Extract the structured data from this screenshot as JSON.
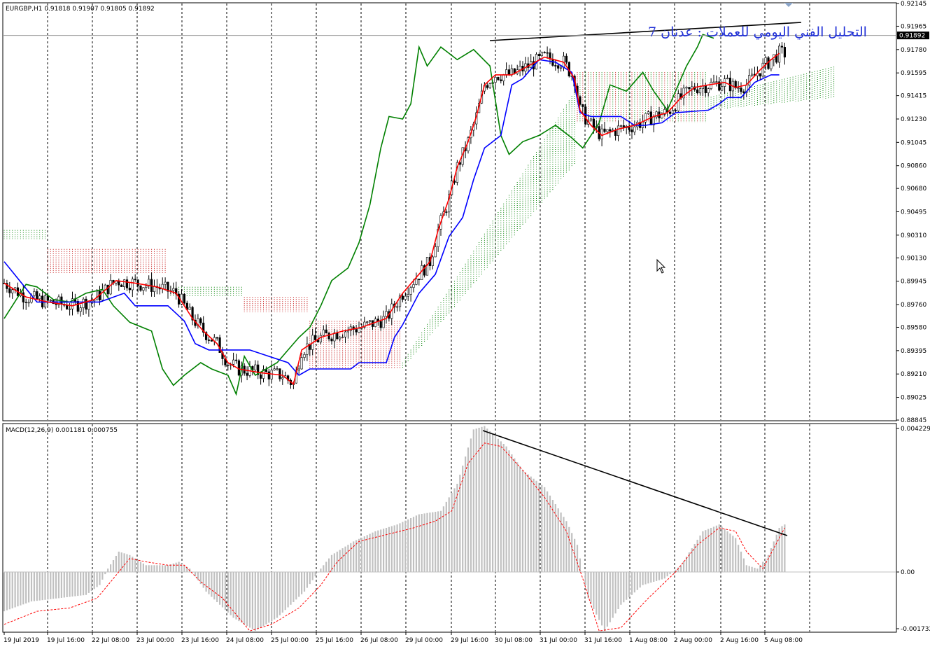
{
  "window": {
    "main_title": "EURGBP,H1  0.91818 0.91907 0.91805 0.91892",
    "macd_title": "MACD(12,26,9) 0.001181 0.000755",
    "annotation": "التحليل الفني اليومي للعملات : عدنان 7",
    "current_price_label": "0.91892"
  },
  "colors": {
    "tenkan": "#ff0000",
    "kijun": "#0000ff",
    "chikou": "#008000",
    "cloud_bull": "#008000",
    "cloud_bear": "#c00000",
    "histogram": "#c0c0c0",
    "signal": "#ff0000",
    "trendline": "#000000",
    "annotation": "#1f2fd6"
  },
  "chart_data": [
    {
      "type": "candlestick",
      "symbol": "EURGBP",
      "timeframe": "H1",
      "indicator": "Ichimoku",
      "ylim": [
        0.88845,
        0.92145
      ],
      "y_ticks": [
        "0.92145",
        "0.91965",
        "0.91780",
        "0.91595",
        "0.91415",
        "0.91230",
        "0.91045",
        "0.90860",
        "0.90680",
        "0.90495",
        "0.90310",
        "0.90130",
        "0.89945",
        "0.89760",
        "0.89580",
        "0.89395",
        "0.89210",
        "0.89025",
        "0.88845"
      ],
      "y_tick_values": [
        0.92145,
        0.91965,
        0.9178,
        0.91595,
        0.91415,
        0.9123,
        0.91045,
        0.9086,
        0.9068,
        0.90495,
        0.9031,
        0.9013,
        0.89945,
        0.8976,
        0.8958,
        0.89395,
        0.8921,
        0.89025,
        0.88845
      ],
      "current_price": 0.91892,
      "x_ticks": [
        "19 Jul 2019",
        "19 Jul 16:00",
        "22 Jul 08:00",
        "23 Jul 00:00",
        "23 Jul 16:00",
        "24 Jul 08:00",
        "25 Jul 00:00",
        "25 Jul 16:00",
        "26 Jul 08:00",
        "29 Jul 00:00",
        "29 Jul 16:00",
        "30 Jul 08:00",
        "31 Jul 00:00",
        "31 Jul 16:00",
        "1 Aug 08:00",
        "2 Aug 00:00",
        "2 Aug 16:00",
        "5 Aug 08:00"
      ],
      "tenkan": [
        [
          0,
          0.8993
        ],
        [
          8,
          0.8982
        ],
        [
          16,
          0.8978
        ],
        [
          25,
          0.8975
        ],
        [
          33,
          0.898
        ],
        [
          41,
          0.8995
        ],
        [
          48,
          0.8993
        ],
        [
          56,
          0.899
        ],
        [
          63,
          0.8985
        ],
        [
          69,
          0.8965
        ],
        [
          73,
          0.8955
        ],
        [
          78,
          0.8945
        ],
        [
          82,
          0.893
        ],
        [
          86,
          0.8925
        ],
        [
          94,
          0.8922
        ],
        [
          102,
          0.892
        ],
        [
          106,
          0.8913
        ],
        [
          109,
          0.894
        ],
        [
          116,
          0.895
        ],
        [
          124,
          0.8955
        ],
        [
          131,
          0.8958
        ],
        [
          140,
          0.8965
        ],
        [
          146,
          0.8985
        ],
        [
          152,
          0.9
        ],
        [
          156,
          0.901
        ],
        [
          159,
          0.9035
        ],
        [
          163,
          0.906
        ],
        [
          166,
          0.9085
        ],
        [
          170,
          0.9105
        ],
        [
          173,
          0.9125
        ],
        [
          176,
          0.915
        ],
        [
          180,
          0.9158
        ],
        [
          186,
          0.9158
        ],
        [
          192,
          0.9165
        ],
        [
          198,
          0.9172
        ],
        [
          205,
          0.9168
        ],
        [
          209,
          0.9155
        ],
        [
          211,
          0.913
        ],
        [
          215,
          0.9118
        ],
        [
          219,
          0.911
        ],
        [
          225,
          0.9115
        ],
        [
          231,
          0.9118
        ],
        [
          238,
          0.9125
        ],
        [
          243,
          0.9128
        ],
        [
          248,
          0.914
        ],
        [
          253,
          0.9148
        ],
        [
          258,
          0.915
        ],
        [
          264,
          0.9152
        ],
        [
          268,
          0.9148
        ],
        [
          272,
          0.915
        ],
        [
          277,
          0.9162
        ],
        [
          281,
          0.917
        ],
        [
          284,
          0.9175
        ]
      ],
      "kijun": [
        [
          0,
          0.901
        ],
        [
          12,
          0.8978
        ],
        [
          25,
          0.8978
        ],
        [
          35,
          0.8978
        ],
        [
          44,
          0.8985
        ],
        [
          48,
          0.8975
        ],
        [
          60,
          0.8975
        ],
        [
          66,
          0.8963
        ],
        [
          70,
          0.8945
        ],
        [
          75,
          0.894
        ],
        [
          90,
          0.894
        ],
        [
          104,
          0.893
        ],
        [
          108,
          0.892
        ],
        [
          112,
          0.8925
        ],
        [
          127,
          0.8925
        ],
        [
          130,
          0.893
        ],
        [
          140,
          0.893
        ],
        [
          143,
          0.895
        ],
        [
          146,
          0.896
        ],
        [
          152,
          0.8985
        ],
        [
          158,
          0.9
        ],
        [
          163,
          0.903
        ],
        [
          168,
          0.9045
        ],
        [
          172,
          0.9075
        ],
        [
          176,
          0.91
        ],
        [
          182,
          0.911
        ],
        [
          186,
          0.915
        ],
        [
          190,
          0.9155
        ],
        [
          196,
          0.917
        ],
        [
          202,
          0.9168
        ],
        [
          208,
          0.916
        ],
        [
          211,
          0.9128
        ],
        [
          215,
          0.9125
        ],
        [
          226,
          0.9125
        ],
        [
          231,
          0.9118
        ],
        [
          235,
          0.9118
        ],
        [
          241,
          0.912
        ],
        [
          246,
          0.9128
        ],
        [
          258,
          0.913
        ],
        [
          262,
          0.9135
        ],
        [
          265,
          0.914
        ],
        [
          270,
          0.914
        ],
        [
          275,
          0.9152
        ],
        [
          281,
          0.9158
        ],
        [
          284,
          0.9158
        ]
      ],
      "chikou": [
        [
          0,
          0.8965
        ],
        [
          8,
          0.8992
        ],
        [
          12,
          0.899
        ],
        [
          18,
          0.898
        ],
        [
          24,
          0.8978
        ],
        [
          30,
          0.8985
        ],
        [
          36,
          0.8988
        ],
        [
          40,
          0.8975
        ],
        [
          46,
          0.8962
        ],
        [
          54,
          0.8955
        ],
        [
          58,
          0.8925
        ],
        [
          62,
          0.8912
        ],
        [
          66,
          0.892
        ],
        [
          72,
          0.893
        ],
        [
          76,
          0.8925
        ],
        [
          82,
          0.892
        ],
        [
          85,
          0.8905
        ],
        [
          88,
          0.8935
        ],
        [
          92,
          0.892
        ],
        [
          100,
          0.893
        ],
        [
          104,
          0.894
        ],
        [
          108,
          0.895
        ],
        [
          112,
          0.8958
        ],
        [
          116,
          0.8975
        ],
        [
          120,
          0.8995
        ],
        [
          126,
          0.9005
        ],
        [
          130,
          0.9025
        ],
        [
          134,
          0.9055
        ],
        [
          138,
          0.91
        ],
        [
          141,
          0.9125
        ],
        [
          146,
          0.9123
        ],
        [
          149,
          0.9135
        ],
        [
          152,
          0.918
        ],
        [
          155,
          0.9165
        ],
        [
          160,
          0.918
        ],
        [
          166,
          0.917
        ],
        [
          172,
          0.9178
        ],
        [
          178,
          0.9165
        ],
        [
          182,
          0.911
        ],
        [
          185,
          0.9095
        ],
        [
          190,
          0.9105
        ],
        [
          196,
          0.911
        ],
        [
          202,
          0.9118
        ],
        [
          208,
          0.9108
        ],
        [
          212,
          0.91
        ],
        [
          218,
          0.912
        ],
        [
          222,
          0.915
        ],
        [
          228,
          0.9145
        ],
        [
          234,
          0.916
        ],
        [
          238,
          0.9145
        ],
        [
          243,
          0.913
        ],
        [
          246,
          0.9145
        ],
        [
          250,
          0.9165
        ],
        [
          254,
          0.918
        ],
        [
          256,
          0.919
        ],
        [
          260,
          0.9187
        ]
      ],
      "cloud": [
        {
          "from": 0,
          "to": 16,
          "senkou_a": 0.9035,
          "senkou_b": 0.9028,
          "color": "bull"
        },
        {
          "from": 16,
          "to": 60,
          "senkou_a": 0.9,
          "senkou_b": 0.902,
          "color": "bear"
        },
        {
          "from": 60,
          "to": 88,
          "senkou_a": 0.899,
          "senkou_b": 0.8982,
          "color": "bull"
        },
        {
          "from": 88,
          "to": 112,
          "senkou_a": 0.897,
          "senkou_b": 0.8982,
          "color": "bear"
        },
        {
          "from": 112,
          "to": 146,
          "senkou_a": 0.8963,
          "senkou_b": 0.8925,
          "color": "bear"
        },
        {
          "from": 146,
          "to": 210,
          "senkou_a_start": 0.893,
          "senkou_a_end": 0.9148,
          "senkou_b_start": 0.8925,
          "senkou_b_end": 0.909,
          "color": "bull"
        },
        {
          "from": 210,
          "to": 258,
          "senkou_a": 0.916,
          "senkou_b": 0.912,
          "color": "mixed"
        },
        {
          "from": 258,
          "to": 305,
          "senkou_a_start": 0.914,
          "senkou_a_end": 0.9165,
          "senkou_b_start": 0.913,
          "senkou_b_end": 0.914,
          "color": "bull"
        }
      ]
    },
    {
      "type": "bar",
      "indicator": "MACD",
      "params": "12,26,9",
      "ylim": [
        -0.001732,
        0.004229
      ],
      "y_ticks": [
        "0.004229",
        "0.00",
        "-0.001732"
      ],
      "y_tick_values": [
        0.004229,
        0.0,
        -0.001732
      ],
      "histogram": [
        [
          0,
          -0.0012
        ],
        [
          10,
          -0.0009
        ],
        [
          20,
          -0.0008
        ],
        [
          30,
          -0.0007
        ],
        [
          35,
          -0.0004
        ],
        [
          38,
          0.0001
        ],
        [
          42,
          0.0006
        ],
        [
          46,
          0.0005
        ],
        [
          52,
          0.0002
        ],
        [
          60,
          0.0002
        ],
        [
          64,
          0.0003
        ],
        [
          68,
          0.0001
        ],
        [
          74,
          -0.0006
        ],
        [
          84,
          -0.0014
        ],
        [
          92,
          -0.0018
        ],
        [
          100,
          -0.0014
        ],
        [
          110,
          -0.0006
        ],
        [
          116,
          0.0001
        ],
        [
          120,
          0.0005
        ],
        [
          128,
          0.0009
        ],
        [
          136,
          0.0012
        ],
        [
          144,
          0.0014
        ],
        [
          152,
          0.0017
        ],
        [
          160,
          0.0018
        ],
        [
          166,
          0.0026
        ],
        [
          172,
          0.0042
        ],
        [
          176,
          0.0043
        ],
        [
          180,
          0.004
        ],
        [
          184,
          0.0037
        ],
        [
          190,
          0.003
        ],
        [
          198,
          0.0025
        ],
        [
          206,
          0.0015
        ],
        [
          210,
          0.0008
        ],
        [
          214,
          -0.0008
        ],
        [
          220,
          -0.0018
        ],
        [
          226,
          -0.001
        ],
        [
          234,
          -0.0004
        ],
        [
          242,
          -0.0002
        ],
        [
          248,
          0.0002
        ],
        [
          256,
          0.0012
        ],
        [
          262,
          0.0014
        ],
        [
          268,
          0.001
        ],
        [
          272,
          0.0002
        ],
        [
          276,
          0.0001
        ],
        [
          280,
          0.0005
        ],
        [
          284,
          0.0013
        ],
        [
          286,
          0.0014
        ]
      ],
      "signal": [
        [
          0,
          -0.0016
        ],
        [
          12,
          -0.0012
        ],
        [
          24,
          -0.0011
        ],
        [
          34,
          -0.0008
        ],
        [
          40,
          -0.0002
        ],
        [
          46,
          0.0004
        ],
        [
          52,
          0.0003
        ],
        [
          60,
          0.0002
        ],
        [
          66,
          0.0002
        ],
        [
          72,
          -0.0003
        ],
        [
          80,
          -0.0008
        ],
        [
          90,
          -0.0018
        ],
        [
          98,
          -0.0016
        ],
        [
          108,
          -0.0011
        ],
        [
          116,
          -0.0004
        ],
        [
          122,
          0.0003
        ],
        [
          130,
          0.0009
        ],
        [
          140,
          0.0011
        ],
        [
          150,
          0.0013
        ],
        [
          158,
          0.0015
        ],
        [
          164,
          0.0018
        ],
        [
          170,
          0.0032
        ],
        [
          176,
          0.0038
        ],
        [
          182,
          0.0037
        ],
        [
          190,
          0.003
        ],
        [
          198,
          0.0022
        ],
        [
          206,
          0.0012
        ],
        [
          212,
          -0.0002
        ],
        [
          218,
          -0.0018
        ],
        [
          226,
          -0.0017
        ],
        [
          236,
          -0.0008
        ],
        [
          246,
          0.0
        ],
        [
          254,
          0.0008
        ],
        [
          262,
          0.0013
        ],
        [
          268,
          0.0012
        ],
        [
          272,
          0.0006
        ],
        [
          278,
          0.0001
        ],
        [
          284,
          0.001
        ],
        [
          286,
          0.0013
        ]
      ]
    }
  ]
}
